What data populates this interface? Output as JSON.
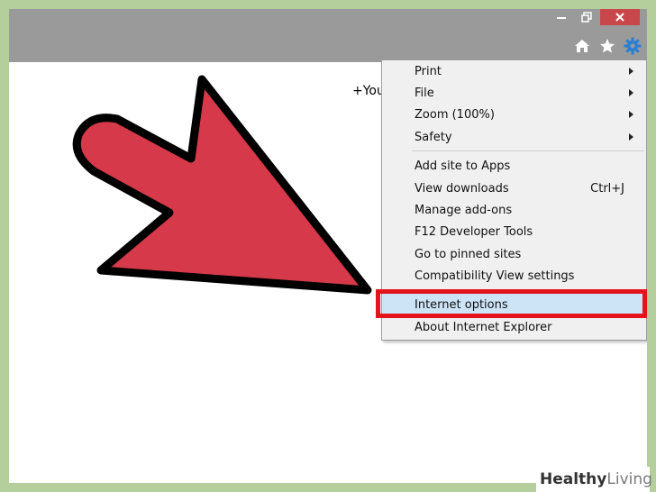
{
  "page": {
    "partial_text": "+You"
  },
  "window": {
    "minimize_icon": "minimize-icon",
    "restore_icon": "restore-icon",
    "close_icon": "close-icon",
    "close_color": "#c7474a"
  },
  "toolbar": {
    "icons": [
      "home-icon",
      "star-icon",
      "gear-icon"
    ],
    "gear_color": "#2a7fd4"
  },
  "menu": {
    "items": [
      {
        "label": "Print",
        "shortcut": "",
        "submenu": true
      },
      {
        "label": "File",
        "shortcut": "",
        "submenu": true
      },
      {
        "label": "Zoom (100%)",
        "shortcut": "",
        "submenu": true
      },
      {
        "label": "Safety",
        "shortcut": "",
        "submenu": true
      },
      {
        "label": "Add site to Apps",
        "shortcut": ""
      },
      {
        "label": "View downloads",
        "shortcut": "Ctrl+J"
      },
      {
        "label": "Manage add-ons",
        "shortcut": ""
      },
      {
        "label": "F12 Developer Tools",
        "shortcut": ""
      },
      {
        "label": "Go to pinned sites",
        "shortcut": ""
      },
      {
        "label": "Compatibility View settings",
        "shortcut": ""
      },
      {
        "label": "Internet options",
        "shortcut": "",
        "highlighted": true
      },
      {
        "label": "About Internet Explorer",
        "shortcut": ""
      }
    ]
  },
  "annotation": {
    "arrow_color": "#d63a4a",
    "highlight_box_color": "#e3141c"
  },
  "watermark": {
    "part1": "Healthy",
    "part2": "Living"
  }
}
